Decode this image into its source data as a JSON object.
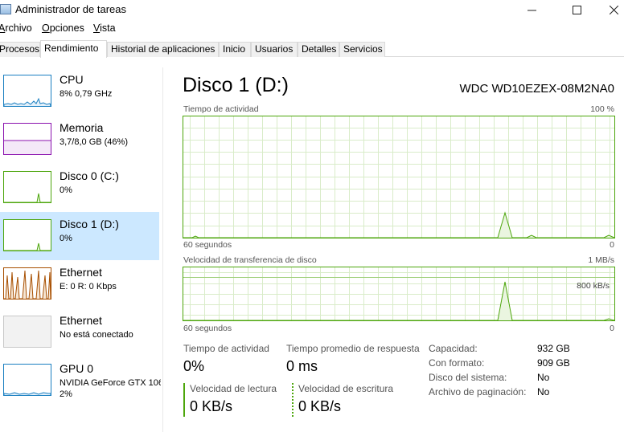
{
  "window": {
    "title": "Administrador de tareas"
  },
  "menu": [
    "Archivo",
    "Opciones",
    "Vista"
  ],
  "tabs": [
    "Procesos",
    "Rendimiento",
    "Historial de aplicaciones",
    "Inicio",
    "Usuarios",
    "Detalles",
    "Servicios"
  ],
  "active_tab": "Rendimiento",
  "sidebar": {
    "items": [
      {
        "name": "CPU",
        "sub": "8% 0,79 GHz",
        "sub2": "",
        "color": "#1a7fc1"
      },
      {
        "name": "Memoria",
        "sub": "3,7/8,0 GB (46%)",
        "sub2": "",
        "color": "#8b12ae"
      },
      {
        "name": "Disco 0 (C:)",
        "sub": "0%",
        "sub2": "",
        "color": "#4da60c"
      },
      {
        "name": "Disco 1 (D:)",
        "sub": "0%",
        "sub2": "",
        "color": "#4da60c"
      },
      {
        "name": "Ethernet",
        "sub": "E: 0 R: 0 Kbps",
        "sub2": "",
        "color": "#a74f01"
      },
      {
        "name": "Ethernet",
        "sub": "No está conectado",
        "sub2": "",
        "color": "#999999"
      },
      {
        "name": "GPU 0",
        "sub": "NVIDIA GeForce GTX 106",
        "sub2": "2%",
        "color": "#1a7fc1"
      }
    ],
    "selected": "Disco 1 (D:)"
  },
  "main": {
    "title": "Disco 1 (D:)",
    "model": "WDC WD10EZEX-08M2NA0",
    "graph1": {
      "label": "Tiempo de actividad",
      "max_label": "100 %",
      "time_label": "60 segundos",
      "min_label": "0"
    },
    "graph2": {
      "label": "Velocidad de transferencia de disco",
      "max_label": "1 MB/s",
      "mid_label": "800 kB/s",
      "time_label": "60 segundos",
      "min_label": "0"
    },
    "stats": {
      "activity_label": "Tiempo de actividad",
      "activity_value": "0%",
      "response_label": "Tiempo promedio de respuesta",
      "response_value": "0 ms",
      "read_label": "Velocidad de lectura",
      "read_value": "0 KB/s",
      "write_label": "Velocidad de escritura",
      "write_value": "0 KB/s"
    },
    "details": [
      {
        "label": "Capacidad:",
        "value": "932 GB"
      },
      {
        "label": "Con formato:",
        "value": "909 GB"
      },
      {
        "label": "Disco del sistema:",
        "value": "No"
      },
      {
        "label": "Archivo de paginación:",
        "value": "No"
      }
    ]
  },
  "colors": {
    "disk": "#4da60c",
    "disk_grid": "#d9ecc9",
    "selected_bg": "#cce8ff"
  }
}
